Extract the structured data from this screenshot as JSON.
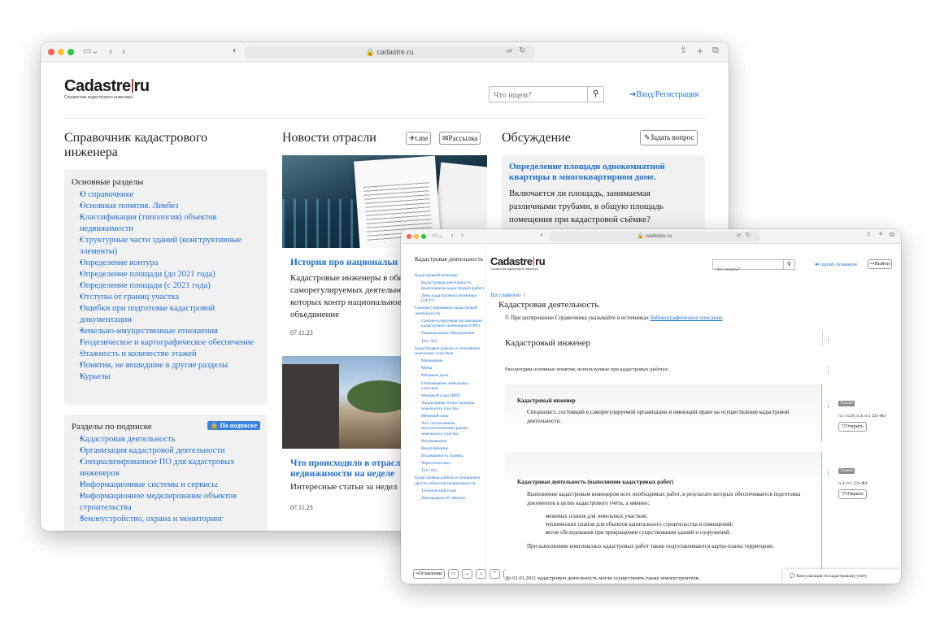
{
  "browser": {
    "url": "cadastre.ru"
  },
  "brand": {
    "name": "Cadastre",
    "name2": "ru",
    "tagline": "Справочник кадастрового инженера"
  },
  "header": {
    "search_placeholder": "Что ищем?",
    "login_label": "Вход/Регистрация"
  },
  "left": {
    "title": "Справочник кадастрового инженера",
    "main_heading": "Основные разделы",
    "main_items": [
      "О справочнике",
      "Основные понятия. Ликбез",
      "Классификация (типология) объектов недвижимости",
      "Структурные части зданий (конструктивные элементы)",
      "Определение контура",
      "Определение площади (до 2021 года)",
      "Определение площади (с 2021 года)",
      "Отступы от границ участка",
      "Ошибки при подготовке кадастровой документации",
      "Земельно-имущественные отношения",
      "Геодезическое и картографическое обеспечение",
      "Этажность и количество этажей",
      "Понятия, не вошедшие в другие разделы",
      "Курьезы"
    ],
    "sub_heading": "Разделы по подписке",
    "sub_badge": "По подписке",
    "sub_items": [
      "Кадастровая деятельность",
      "Организация кадастровой деятельности",
      "Специализированное ПО для кадастровых инженеров",
      "Информационные системы и сервисы",
      "Информационное моделирование объектов строительства",
      "Землеустройство, охрана и мониторинг"
    ]
  },
  "news": {
    "title": "Новости отрасли",
    "tme": "t.me",
    "mail": "Рассылка",
    "items": [
      {
        "title": "История про национальн",
        "text": "Кадастровые инженеры в обя состоят в саморегулируемых деятельность которых контр национальное объединение",
        "date": "07.11.23"
      },
      {
        "title": "Что происходило в отрасл недвижимости на неделе",
        "text": "Интересные статьи за недел",
        "date": "07.11.23"
      }
    ]
  },
  "discuss": {
    "title": "Обсуждение",
    "ask": "Задать вопрос",
    "q_title": "Определение площади однокомнатной квартиры в многоквартирном доме.",
    "q_text": "Включается ли площадь, занимаемая различными трубами, в общую площадь помещения при кадастровой съёмке?"
  },
  "w2": {
    "toc_title": "Кадастровая деятельность",
    "toc": [
      {
        "t": "Кадастровый инженер",
        "l": 0
      },
      {
        "t": "Кадастровая деятельность (выполнение кадастровых работ)",
        "l": 1
      },
      {
        "t": "День кадастрового инженера (24.07)",
        "l": 1
      },
      {
        "t": "Саморегулирование кадастровой деятельности",
        "l": 0
      },
      {
        "t": "Саморегулируемая организация кадастровых инженеров (СРО)",
        "l": 1
      },
      {
        "t": "Национальное объединение",
        "l": 1
      },
      {
        "t": "Тест №1",
        "l": 1
      },
      {
        "t": "Кадастровые работы в отношении земельных участков",
        "l": 0
      },
      {
        "t": "Межевание",
        "l": 1
      },
      {
        "t": "Межа",
        "l": 1
      },
      {
        "t": "Межевое дело",
        "l": 1
      },
      {
        "t": "Отмежевание земельных участков",
        "l": 1
      },
      {
        "t": "Межевой план (МП)",
        "l": 1
      },
      {
        "t": "Характерная точка границы земельного участка",
        "l": 1
      },
      {
        "t": "Межевой знак",
        "l": 1
      },
      {
        "t": "Акт согласования местоположения границ земельного участка",
        "l": 1
      },
      {
        "t": "Вклинивание",
        "l": 1
      },
      {
        "t": "Вкрапливание",
        "l": 1
      },
      {
        "t": "Изломанность границ",
        "l": 1
      },
      {
        "t": "Чересполосица",
        "l": 1
      },
      {
        "t": "Тест №2",
        "l": 1
      },
      {
        "t": "Кадастровые работы в отношении других объектов недвижимости",
        "l": 0
      },
      {
        "t": "Технический план",
        "l": 1
      },
      {
        "t": "Декларация об объекте",
        "l": 1
      }
    ],
    "toolbar_label": "Оглавление",
    "search_placeholder": "Что ищем?",
    "user": "Сергей Атаманов",
    "logout": "Выйти",
    "breadcrumb": "На главную",
    "bc_sep": "/",
    "page_title": "Кадастровая деятельность",
    "cite_pre": "© При цитировании Справочника указывайте в источниках ",
    "cite_link": "библиографическое описание",
    "section": "Кадастровый инженер",
    "intro": "Рассмотрим основные понятия, используемые при кадастровых работах.",
    "term1_title": "Кадастровый инженер",
    "term1_text": "Специалист, состоящий в саморегулируемой организации и имеющий право на осуществление кадастровой деятельности.",
    "term_badge": "Термин",
    "term1_ref": "п.1 ст.29, п.4 ст.1 221-ФЗ",
    "open": "Открыть",
    "term2_title": "Кадастровая деятельность (выполнение кадастровых работ)",
    "term2_text": "Выполнение кадастровым инженером всех необходимых работ, в результате которых обеспечивается подготовка документов в целях кадастрового учёта, а именно:",
    "term2_list": [
      "межевых планов для земельных участков;",
      "технических планов для объектов капитального строительства и помещений;",
      "актов обследования при прекращении существования зданий и сооружений."
    ],
    "term2_note": "При выполнении комплексных кадастровых работ также подготавливаются карты-планы территории.",
    "term2_ref": "п.4 ст.1 221-ФЗ",
    "bottom": "До 01.01.2011 кадастровую деятельность могли осуществлять также землеустроители.",
    "consult": "Консультация по кадастровому учету"
  },
  "colors": {
    "link": "#1f6fd0",
    "accent_bar": "#c0392b",
    "term_badge": "#8a8a8a",
    "green_rule": "#6fcf6f"
  }
}
